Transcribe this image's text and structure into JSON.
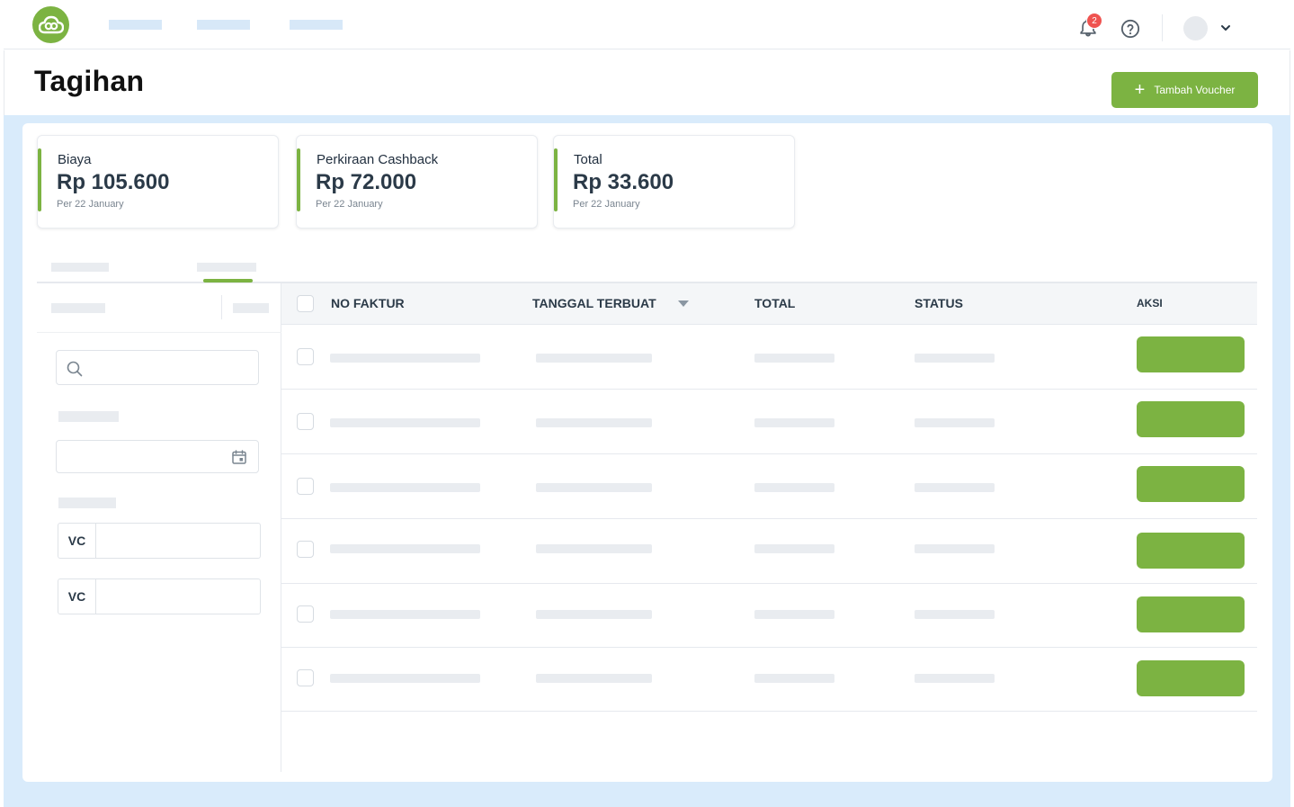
{
  "header": {
    "title": "Tagihan",
    "add_button_label": "Tambah Voucher"
  },
  "topnav": {
    "notification_count": "2"
  },
  "summary": [
    {
      "label": "Biaya",
      "value": "Rp 105.600",
      "sub": "Per 22 January"
    },
    {
      "label": "Perkiraan Cashback",
      "value": "Rp 72.000",
      "sub": "Per 22 January"
    },
    {
      "label": "Total",
      "value": "Rp 33.600",
      "sub": "Per 22 January"
    }
  ],
  "filters": {
    "voucher_prefix_1": "VC",
    "voucher_prefix_2": "VC"
  },
  "table": {
    "columns": [
      "NO FAKTUR",
      "TANGGAL TERBUAT",
      "TOTAL",
      "STATUS",
      "AKSI"
    ]
  },
  "colors": {
    "accent": "#7cb342",
    "background": "#d9ebfb",
    "badge": "#ef5350"
  },
  "icons": [
    "logo-icon",
    "bell-icon",
    "help-icon",
    "chevron-down-icon",
    "plus-icon",
    "search-icon",
    "calendar-icon",
    "sort-down-icon"
  ]
}
